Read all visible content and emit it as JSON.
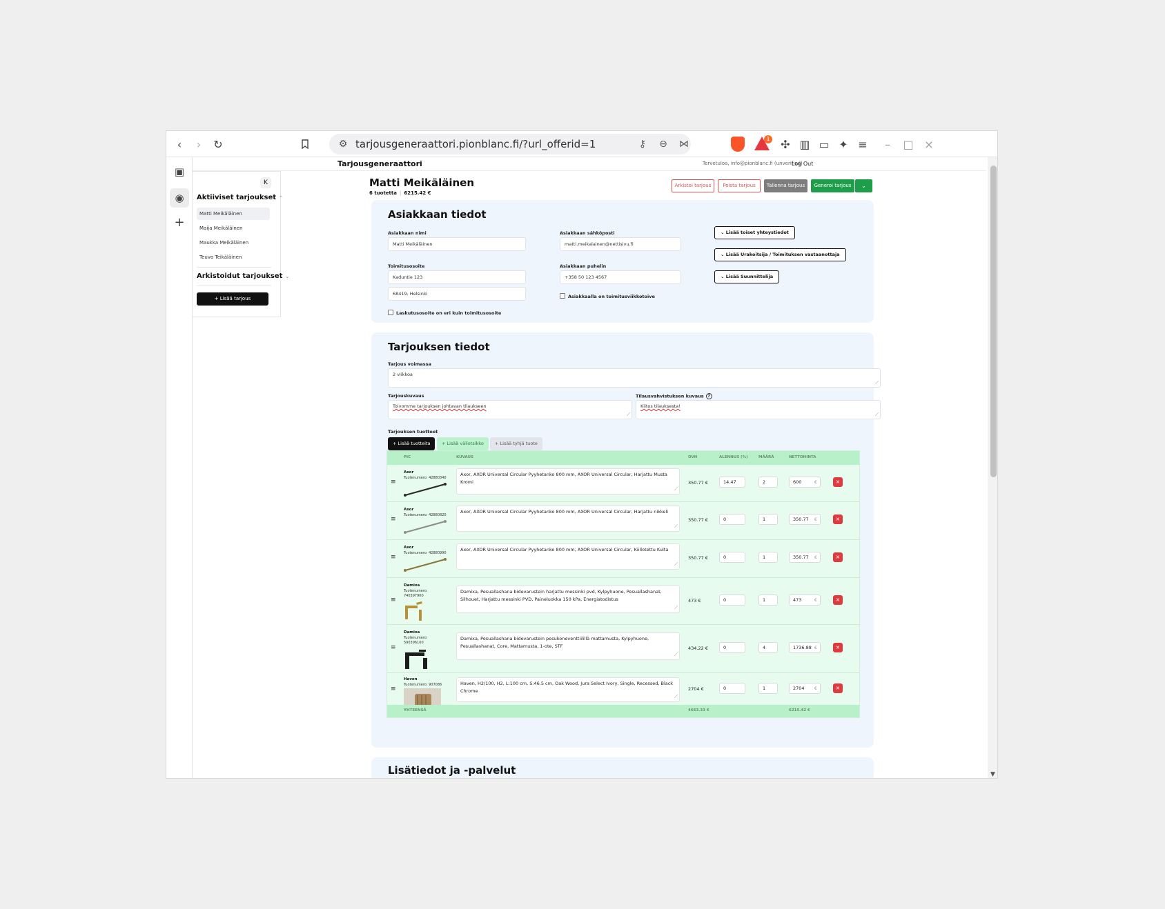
{
  "browser": {
    "url": "tarjousgeneraattori.pionblanc.fi/?url_offerid=1",
    "alert_count": "1"
  },
  "header": {
    "app_title": "Tarjousgeneraattori",
    "welcome": "Tervetuloa, info@pionblanc.fi (unverified)",
    "logout": "Log Out"
  },
  "sidebar": {
    "active_heading": "Aktiiviset tarjoukset",
    "active_items": [
      "Matti Meikäläinen",
      "Maija Meikäläinen",
      "Maukka Meikäläinen",
      "Teuvo Teikäläinen"
    ],
    "archived_heading": "Arkistoidut tarjoukset",
    "add_button": "+ Lisää tarjous"
  },
  "offer": {
    "customer_name": "Matti Meikäläinen",
    "product_count": "6 tuotetta",
    "total": "6215.42 €",
    "buttons": {
      "archive": "Arkistoi tarjous",
      "delete": "Poista tarjous",
      "save": "Tallenna tarjous",
      "generate": "Generoi tarjous"
    }
  },
  "customer": {
    "title": "Asiakkaan tiedot",
    "name_label": "Asiakkaan nimi",
    "name_value": "Matti Meikäläinen",
    "email_label": "Asiakkaan sähköposti",
    "email_value": "matti.meikalainen@nettisivu.fi",
    "address_label": "Toimitusosoite",
    "address_line1": "Kaduntie 123",
    "address_line2": "68419, Helsinki",
    "phone_label": "Asiakkaan puhelin",
    "phone_value": "+358 50 123 4567",
    "vat_checkbox": "Asiakkaalla on toimitusviikkotoive",
    "billing_checkbox": "Laskutusosoite on eri kuin toimitusosoite",
    "btn_contacts": "Lisää toiset yhteystiedot",
    "btn_contractor": "Lisää Urakoitsija / Toimituksen vastaanottaja",
    "btn_designer": "Lisää Suunnittelija"
  },
  "details": {
    "title": "Tarjouksen tiedot",
    "validity_label": "Tarjous voimassa",
    "validity_value": "2 viikkoa",
    "desc_label": "Tarjouskuvaus",
    "desc_value": "Toivomme tarjouksen johtavan tilaukseen",
    "confirm_label": "Tilausvahvistuksen kuvaus",
    "confirm_value": "Kiitos tilauksesta!",
    "products_label": "Tarjouksen tuotteet",
    "btn_add_products": "+ Lisää tuotteita",
    "btn_add_subheading": "+ Lisää väliotsikko",
    "btn_add_empty": "+ Lisää tyhjä tuote"
  },
  "table": {
    "headers": {
      "pic": "PIC",
      "desc": "KUVAUS",
      "price": "OVH",
      "discount": "ALENNUS (%)",
      "qty": "MÄÄRÄ",
      "net": "NETTOHINTA"
    },
    "rows": [
      {
        "brand": "Axor",
        "number": "Tuotenumero: 42880340",
        "desc": "Axor, AXOR Universal Circular Pyyhetanko 800 mm, AXOR Universal Circular, Harjattu Musta Kromi",
        "price": "350.77 €",
        "discount": "14.47",
        "qty": "2",
        "net": "600"
      },
      {
        "brand": "Axor",
        "number": "Tuotenumero: 42880820",
        "desc": "Axor, AXOR Universal Circular Pyyhetanko 800 mm, AXOR Universal Circular, Harjattu nikkeli",
        "price": "350.77 €",
        "discount": "0",
        "qty": "1",
        "net": "350.77"
      },
      {
        "brand": "Axor",
        "number": "Tuotenumero: 42880990",
        "desc": "Axor, AXOR Universal Circular Pyyhetanko 800 mm, AXOR Universal Circular, Kiillotettu Kulta",
        "price": "350.77 €",
        "discount": "0",
        "qty": "1",
        "net": "350.77"
      },
      {
        "brand": "Damixa",
        "number": "Tuotenumero: 740397900",
        "desc": "Damixa, Pesuallashana bidevarustein  harjattu messinki pvd, Kylpyhuone, Pesuallashanat, Silhouet, Harjattu messinki PVD, Paineluokka 150 kPa, Energiatodistus",
        "price": "473 €",
        "discount": "0",
        "qty": "1",
        "net": "473"
      },
      {
        "brand": "Damixa",
        "number": "Tuotenumero: 590396100",
        "desc": "Damixa, Pesuallashana bidevarustein pesukoneventtiilillä mattamusta, Kylpyhuone, Pesuallashanat, Core, Mattamusta, 1-ote, STF",
        "price": "434.22 €",
        "discount": "0",
        "qty": "4",
        "net": "1736.88"
      },
      {
        "brand": "Haven",
        "number": "Tuotenumero: 907086",
        "desc": "Haven, H2/100, H2, L:100 cm, S:46.5 cm, Oak Wood, Jura Select Ivory, Single, Recessed, Black Chrome",
        "price": "2704 €",
        "discount": "0",
        "qty": "1",
        "net": "2704"
      }
    ],
    "footer_label": "YHTEENSÄ",
    "footer_price_total": "4663.33 €",
    "footer_net_total": "6215.42 €",
    "euro": "€",
    "delete_glyph": "×",
    "drag_glyph": "≡"
  },
  "extra": {
    "title": "Lisätiedot ja -palvelut"
  }
}
